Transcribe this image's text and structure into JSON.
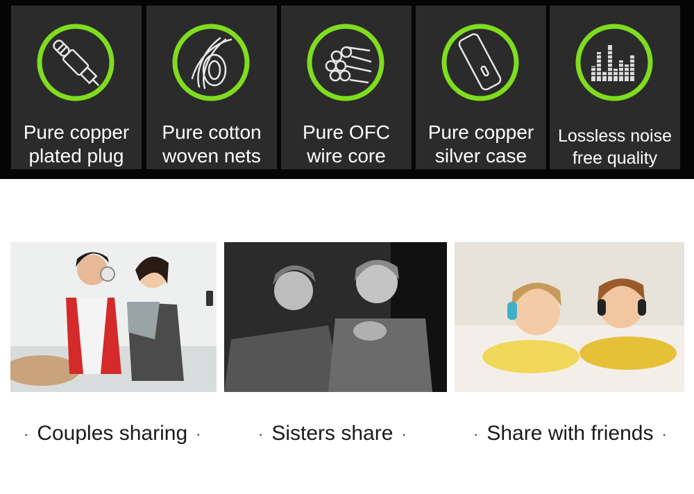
{
  "features": [
    {
      "icon": "audio-plug-icon",
      "line1": "Pure copper",
      "line2": "plated plug"
    },
    {
      "icon": "woven-net-icon",
      "line1": "Pure cotton",
      "line2": "woven nets"
    },
    {
      "icon": "wire-core-icon",
      "line1": "Pure OFC",
      "line2": "wire core"
    },
    {
      "icon": "silver-case-icon",
      "line1": "Pure copper",
      "line2": "silver case"
    },
    {
      "icon": "equalizer-icon",
      "line1": "Lossless noise",
      "line2": "free quality"
    }
  ],
  "scenes": [
    {
      "caption": "Couples sharing"
    },
    {
      "caption": "Sisters share"
    },
    {
      "caption": "Share with friends"
    }
  ],
  "colors": {
    "accent": "#7fdc1f",
    "card": "#2b2b2b",
    "band": "#050505"
  }
}
